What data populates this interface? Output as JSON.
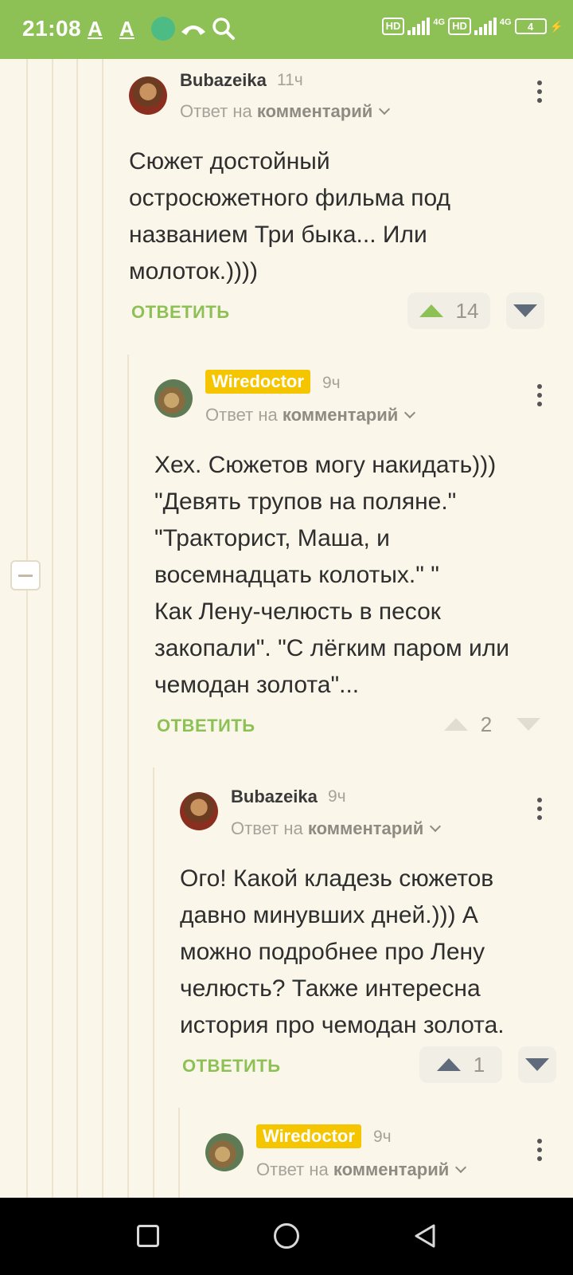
{
  "status_bar": {
    "time": "21:08",
    "hd1": "HD",
    "net1": "4G",
    "hd2": "HD",
    "net2": "4G",
    "battery": "4",
    "accent": "#8ec155"
  },
  "comments": [
    {
      "username": "Bubazeika",
      "time": "11ч",
      "reply_prefix": "Ответ на",
      "reply_link": "комментарий",
      "text": "Сюжет достойный\nостросюжетного фильма под\nназванием Три быка... Или\nмолоток.))))",
      "reply_label": "ОТВЕТИТЬ",
      "votes": "14"
    },
    {
      "username": "Wiredoctor",
      "time": "9ч",
      "reply_prefix": "Ответ на",
      "reply_link": "комментарий",
      "text": "Хех. Сюжетов могу накидать)))\n\"Девять трупов на поляне.\"\n\"Тракторист, Маша, и\nвосемнадцать колотых.\" \"\nКак Лену-челюсть в песок\nзакопали\". \"С лёгким паром или\nчемодан золота\"...",
      "reply_label": "ОТВЕТИТЬ",
      "votes": "2"
    },
    {
      "username": "Bubazeika",
      "time": "9ч",
      "reply_prefix": "Ответ на",
      "reply_link": "комментарий",
      "text": "Ого! Какой кладезь сюжетов\nдавно минувших дней.))) А\nможно подробнее про Лену\nчелюсть? Также интересна\nистория про чемодан золота.",
      "reply_label": "ОТВЕТИТЬ",
      "votes": "1"
    },
    {
      "username": "Wiredoctor",
      "time": "9ч",
      "reply_prefix": "Ответ на",
      "reply_link": "комментарий"
    }
  ]
}
